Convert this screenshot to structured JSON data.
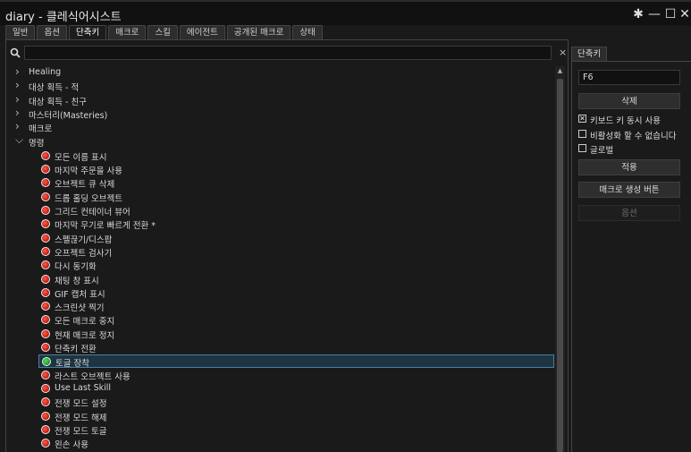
{
  "window": {
    "title": "diary - 클레식어시스트"
  },
  "controls": {
    "bug": "✱",
    "minimize": "—",
    "maximize": "☐",
    "close": "✕"
  },
  "tabs": [
    "일반",
    "옵션",
    "단축키",
    "매크로",
    "스킬",
    "에이전트",
    "공개된 매크로",
    "상태"
  ],
  "search": {
    "value": "",
    "placeholder": "",
    "clear": "×"
  },
  "tree": {
    "categories": [
      {
        "label": "Healing",
        "expanded": false
      },
      {
        "label": "대상 획득 - 적",
        "expanded": false
      },
      {
        "label": "대상 획득 - 친구",
        "expanded": false
      },
      {
        "label": "마스터리(Masteries)",
        "expanded": false
      },
      {
        "label": "매크로",
        "expanded": false
      },
      {
        "label": "명령",
        "expanded": true
      }
    ],
    "commands": [
      "모든 이름 표시",
      "마지막 주문을 사용",
      "오브젝트 큐 삭제",
      "드롭 홀딩 오브젝트",
      "그리드 컨테이너 뷰어",
      "마지막 무기로 빠르게 전환 *",
      "스펠끊기/디스팝",
      "오프젝트 검사기",
      "다시 동기화",
      "채팅 창 표시",
      "GIF 캡처 표시",
      "스크린샷 찍기",
      "모든 매크로 중지",
      "현재 매크로 정지",
      "단축키 전환",
      "토글 장착",
      "라스트 오브젝트 사용",
      "Use Last Skill",
      "전쟁 모드 설정",
      "전쟁 모드 해제",
      "전쟁 모드 토글",
      "왼손 사용"
    ],
    "selected_index": 15
  },
  "hotkey_panel": {
    "tab_label": "단축키",
    "key_value": "F6",
    "delete_label": "삭제",
    "checkboxes": [
      {
        "label": "키보드 키 동시 사용",
        "checked": true,
        "mark": "✕"
      },
      {
        "label": "비활성화 할 수 없습니다",
        "checked": false,
        "mark": ""
      },
      {
        "label": "글로벌",
        "checked": false,
        "mark": ""
      }
    ],
    "apply_label": "적용",
    "create_macro_label": "매크로 생성 버튼",
    "options_label": "옵션"
  },
  "colors": {
    "accent_selected_border": "#4a7fa0",
    "dot_red": "#c01a10",
    "dot_green": "#1a9a28"
  }
}
